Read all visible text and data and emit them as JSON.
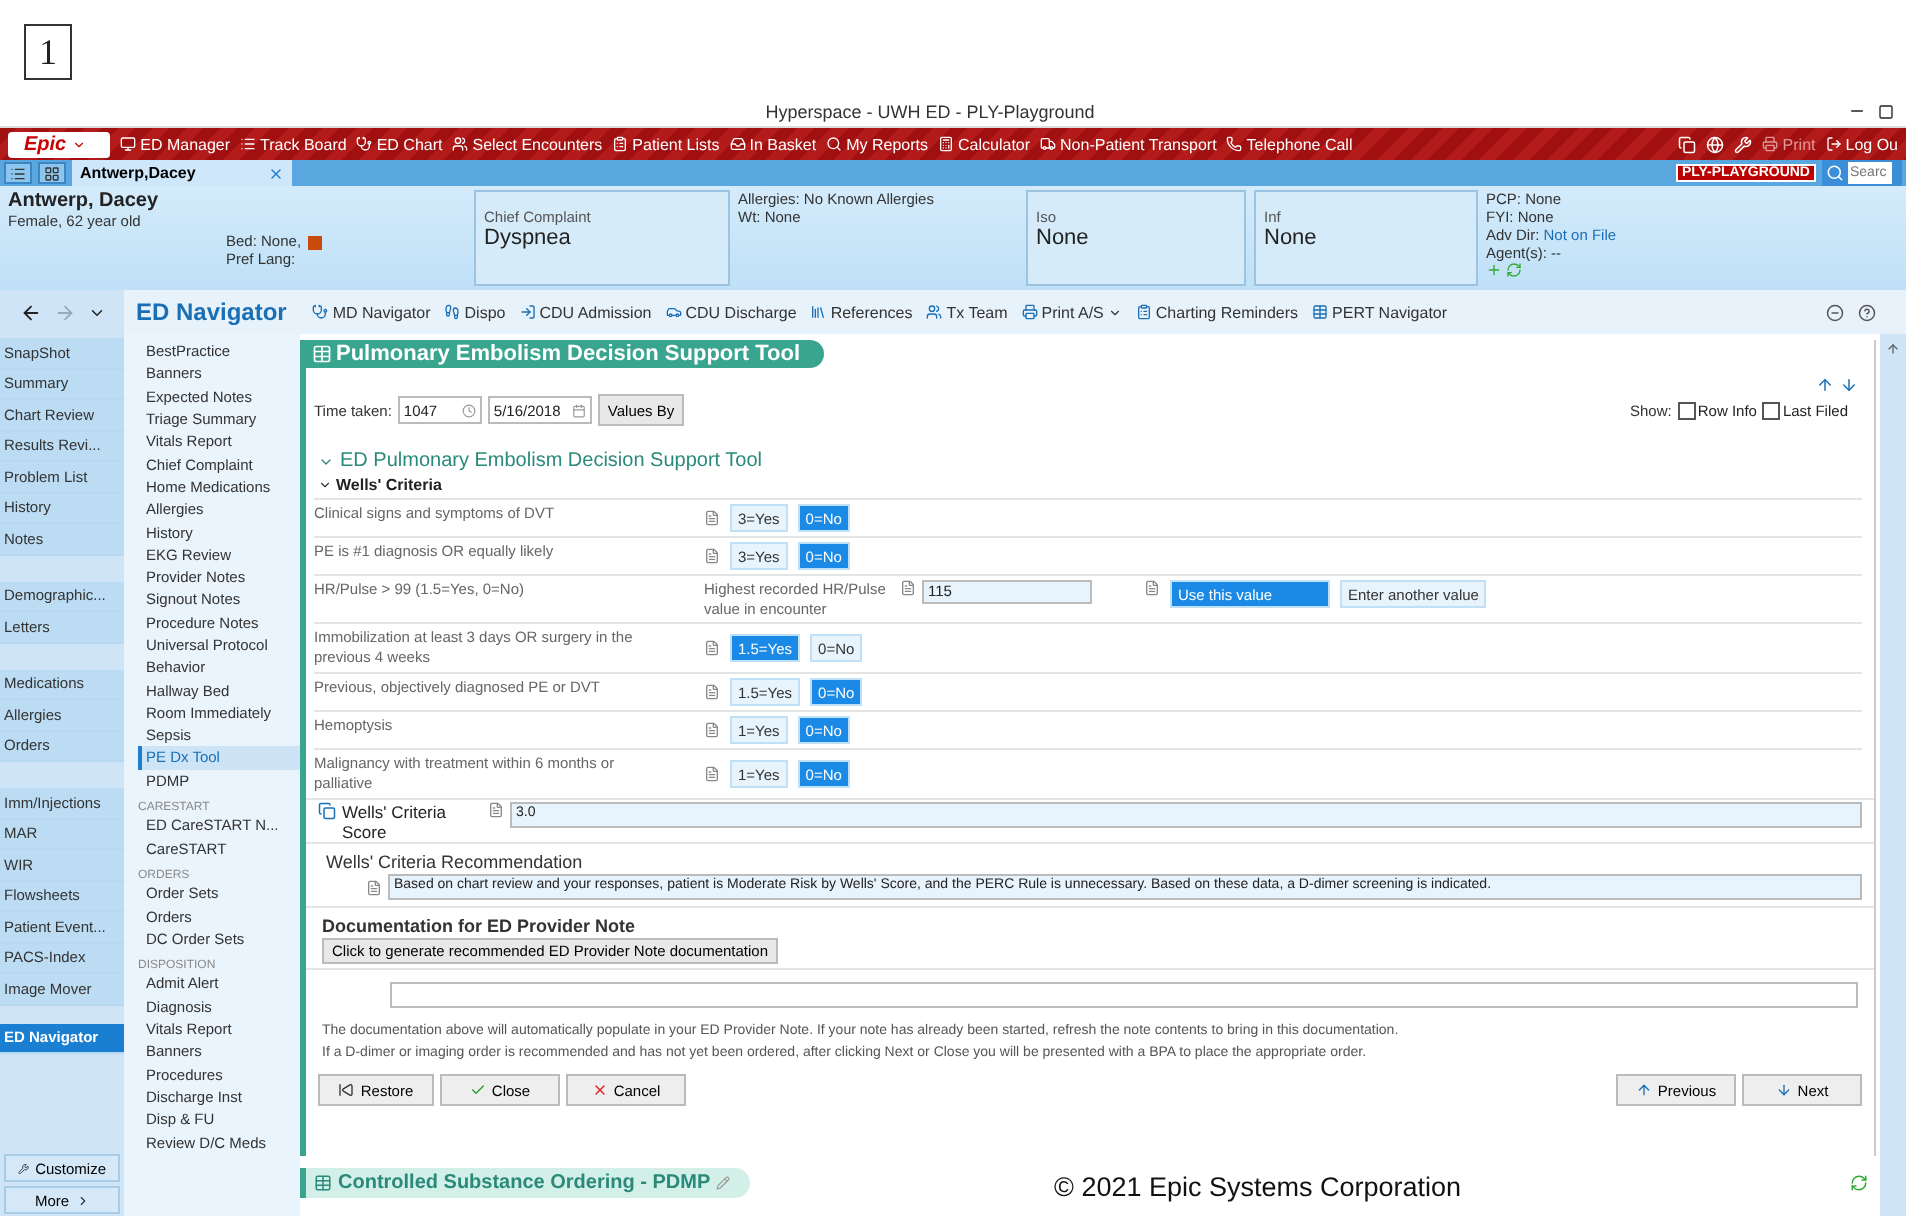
{
  "figure_label": "1",
  "window": {
    "title": "Hyperspace - UWH ED - PLY-Playground"
  },
  "toolbar": {
    "logo": "Epic",
    "items": [
      {
        "label": "ED Manager"
      },
      {
        "label": "Track Board"
      },
      {
        "label": "ED Chart"
      },
      {
        "label": "Select Encounters"
      },
      {
        "label": "Patient Lists"
      },
      {
        "label": "In Basket"
      },
      {
        "label": "My Reports"
      },
      {
        "label": "Calculator"
      },
      {
        "label": "Non-Patient Transport"
      },
      {
        "label": "Telephone Call"
      }
    ],
    "right_items": [
      {
        "label": "Print",
        "disabled": true
      },
      {
        "label": "Log Ou",
        "disabled": false
      }
    ]
  },
  "tab_row": {
    "patient_tab": "Antwerp,Dacey",
    "environment": "PLY-PLAYGROUND",
    "search_placeholder": "Searc"
  },
  "patient": {
    "name": "Antwerp, Dacey",
    "info": "Female, 62 year old",
    "bed": "Bed: None,",
    "pref_lang": "Pref Lang:",
    "chief_complaint": {
      "label": "Chief Complaint",
      "value": "Dyspnea"
    },
    "allergies": "Allergies: No Known Allergies",
    "wt": "Wt: None",
    "iso": {
      "label": "Iso",
      "value": "None"
    },
    "inf": {
      "label": "Inf",
      "value": "None"
    },
    "pcp": "PCP: None",
    "fyi": "FYI: None",
    "adv_dir": {
      "label": "Adv Dir:",
      "value": "Not on File"
    },
    "agents": "Agent(s): --"
  },
  "activity_title": "ED Navigator",
  "nav_toolbar": [
    {
      "label": "MD Navigator"
    },
    {
      "label": "Dispo"
    },
    {
      "label": "CDU Admission"
    },
    {
      "label": "CDU Discharge"
    },
    {
      "label": "References"
    },
    {
      "label": "Tx Team"
    },
    {
      "label": "Print A/S"
    },
    {
      "label": "Charting Reminders"
    },
    {
      "label": "PERT Navigator"
    }
  ],
  "sidebar": {
    "groups": [
      [
        {
          "label": "SnapShot",
          "selected": false
        },
        {
          "label": "Summary",
          "selected": false
        },
        {
          "label": "Chart Review",
          "selected": false
        },
        {
          "label": "Results Revi...",
          "selected": false
        },
        {
          "label": "Problem List",
          "selected": false
        },
        {
          "label": "History",
          "selected": false
        },
        {
          "label": "Notes",
          "selected": false
        }
      ],
      [
        {
          "label": "Demographic...",
          "selected": false
        },
        {
          "label": "Letters",
          "selected": false
        }
      ],
      [
        {
          "label": "Medications",
          "selected": false
        },
        {
          "label": "Allergies",
          "selected": false
        },
        {
          "label": "Orders",
          "selected": false
        }
      ],
      [
        {
          "label": "Imm/Injections",
          "selected": false
        },
        {
          "label": "MAR",
          "selected": false
        },
        {
          "label": "WIR",
          "selected": false
        },
        {
          "label": "Flowsheets",
          "selected": false
        },
        {
          "label": "Patient Event...",
          "selected": false
        },
        {
          "label": "PACS-Index",
          "selected": false
        },
        {
          "label": "Image Mover",
          "selected": false
        }
      ],
      [
        {
          "label": "ED Navigator",
          "selected": true
        }
      ]
    ],
    "customize": "Customize",
    "more": "More"
  },
  "navigator": {
    "sections": [
      {
        "items": [
          {
            "label": "BestPractice",
            "selected": false
          },
          {
            "label": "Banners",
            "selected": false
          },
          {
            "label": "Expected Notes",
            "selected": false
          },
          {
            "label": "Triage Summary",
            "selected": false
          },
          {
            "label": "Vitals Report",
            "selected": false
          },
          {
            "label": "Chief Complaint",
            "selected": false
          },
          {
            "label": "Home Medications",
            "selected": false
          },
          {
            "label": "Allergies",
            "selected": false
          },
          {
            "label": "History",
            "selected": false
          },
          {
            "label": "EKG Review",
            "selected": false
          },
          {
            "label": "Provider Notes",
            "selected": false
          },
          {
            "label": "Signout Notes",
            "selected": false
          },
          {
            "label": "Procedure Notes",
            "selected": false
          },
          {
            "label": "Universal Protocol",
            "selected": false
          },
          {
            "label": "Behavior",
            "selected": false
          },
          {
            "label": "Hallway Bed",
            "selected": false
          },
          {
            "label": "Room Immediately",
            "selected": false
          },
          {
            "label": "Sepsis",
            "selected": false
          },
          {
            "label": "PE Dx Tool",
            "selected": true
          },
          {
            "label": "PDMP",
            "selected": false
          }
        ]
      },
      {
        "header": "CARESTART",
        "items": [
          {
            "label": "ED CareSTART N...",
            "selected": false
          },
          {
            "label": "CareSTART",
            "selected": false
          }
        ]
      },
      {
        "header": "ORDERS",
        "items": [
          {
            "label": "Order Sets",
            "selected": false
          },
          {
            "label": "Orders",
            "selected": false
          },
          {
            "label": "DC Order Sets",
            "selected": false
          }
        ]
      },
      {
        "header": "DISPOSITION",
        "items": [
          {
            "label": "Admit Alert",
            "selected": false
          },
          {
            "label": "Diagnosis",
            "selected": false
          },
          {
            "label": "Vitals Report",
            "selected": false
          },
          {
            "label": "Banners",
            "selected": false
          },
          {
            "label": "Procedures",
            "selected": false
          },
          {
            "label": "Discharge Inst",
            "selected": false
          },
          {
            "label": "Disp & FU",
            "selected": false
          },
          {
            "label": "Review D/C Meds",
            "selected": false
          }
        ]
      }
    ]
  },
  "form": {
    "title": "Pulmonary Embolism Decision Support Tool",
    "time_label": "Time taken:",
    "time": "1047",
    "date": "5/16/2018",
    "values_by": "Values By",
    "show_label": "Show:",
    "show_options": [
      {
        "label": "Row Info",
        "checked": false
      },
      {
        "label": "Last Filed",
        "checked": false
      }
    ],
    "section_title": "ED Pulmonary Embolism Decision Support Tool",
    "subsection": "Wells' Criteria",
    "criteria": [
      {
        "kind": "toggle",
        "label": "Clinical signs and symptoms of DVT",
        "options": [
          {
            "label": "3=Yes",
            "selected": false
          },
          {
            "label": "0=No",
            "selected": true
          }
        ]
      },
      {
        "kind": "toggle",
        "label": "PE is #1 diagnosis OR equally likely",
        "options": [
          {
            "label": "3=Yes",
            "selected": false
          },
          {
            "label": "0=No",
            "selected": true
          }
        ]
      },
      {
        "kind": "value",
        "label": "HR/Pulse > 99    (1.5=Yes, 0=No)",
        "value_label": "Highest recorded HR/Pulse value in encounter",
        "value": "115",
        "options": [
          {
            "label": "Use this value",
            "selected": true
          },
          {
            "label": "Enter another value",
            "selected": false
          }
        ]
      },
      {
        "kind": "toggle",
        "label": "Immobilization at least 3 days OR surgery in the previous 4 weeks",
        "options": [
          {
            "label": "1.5=Yes",
            "selected": true
          },
          {
            "label": "0=No",
            "selected": false
          }
        ]
      },
      {
        "kind": "toggle",
        "label": "Previous, objectively diagnosed PE or DVT",
        "options": [
          {
            "label": "1.5=Yes",
            "selected": false
          },
          {
            "label": "0=No",
            "selected": true
          }
        ]
      },
      {
        "kind": "toggle",
        "label": "Hemoptysis",
        "options": [
          {
            "label": "1=Yes",
            "selected": false
          },
          {
            "label": "0=No",
            "selected": true
          }
        ]
      },
      {
        "kind": "toggle",
        "label": "Malignancy with treatment within 6 months or palliative",
        "options": [
          {
            "label": "1=Yes",
            "selected": false
          },
          {
            "label": "0=No",
            "selected": true
          }
        ]
      }
    ],
    "score_label": "Wells' Criteria Score",
    "score": "3.0",
    "recommendation_title": "Wells' Criteria Recommendation",
    "recommendation": "Based on chart review and your responses, patient is Moderate Risk by Wells' Score, and the PERC Rule is unnecessary. Based on these data, a D-dimer screening is indicated.",
    "documentation_title": "Documentation for ED Provider Note",
    "generate_button": "Click to generate recommended ED Provider Note documentation",
    "info": [
      "The documentation above will automatically populate in your ED Provider Note.  If your note has already been started, refresh the note contents to bring in this documentation.",
      "If a D-dimer or imaging order is recommended and has not yet been ordered, after clicking Next or Close you will be presented with a BPA to place the appropriate order."
    ],
    "buttons": [
      {
        "kind": "restore",
        "label": "Restore"
      },
      {
        "kind": "close",
        "label": "Close"
      },
      {
        "kind": "cancel",
        "label": "Cancel"
      },
      {
        "kind": "previous",
        "label": "Previous"
      },
      {
        "kind": "next",
        "label": "Next"
      }
    ]
  },
  "next_section": "Controlled Substance Ordering - PDMP",
  "copyright": "© 2021 Epic Systems Corporation"
}
